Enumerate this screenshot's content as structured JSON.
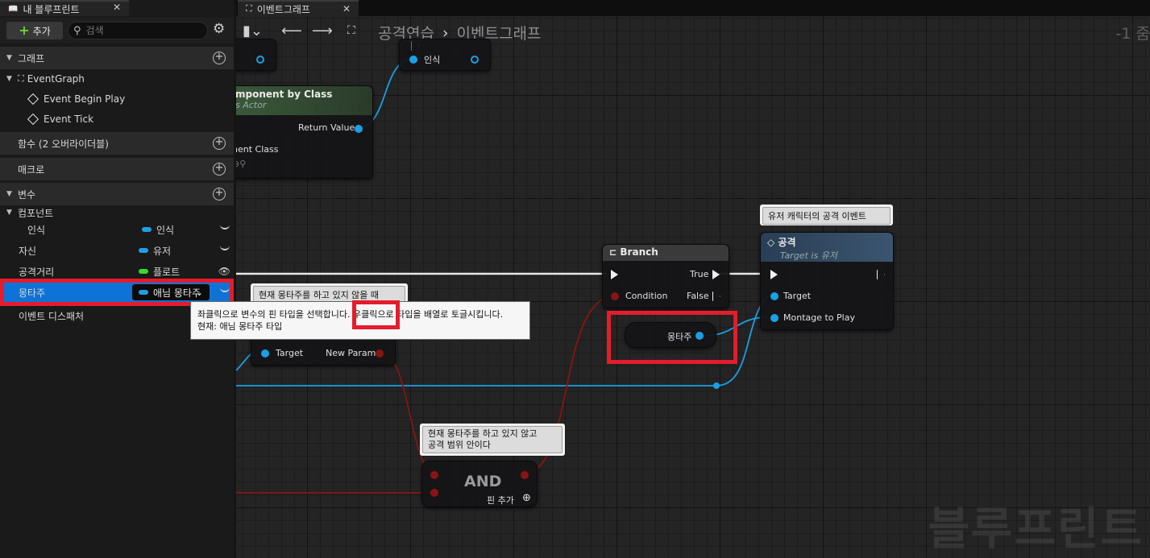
{
  "left_panel": {
    "tab_title": "내 블루프린트",
    "add_label": "추가",
    "search_placeholder": "검색",
    "sections": {
      "graphs": "그래프",
      "functions": "함수 (2 오버라이더블)",
      "macros": "매크로",
      "variables": "변수"
    },
    "event_graph": "EventGraph",
    "events": [
      "Event Begin Play",
      "Event Tick"
    ],
    "components_label": "컴포넌트",
    "variables": [
      {
        "name": "인식",
        "type": "인식",
        "color": "#1e9ee8"
      },
      {
        "name": "자신",
        "type": "유저",
        "color": "#1e9ee8"
      },
      {
        "name": "공격거리",
        "type": "플로트",
        "color": "#38d82a"
      },
      {
        "name": "몽타주",
        "type": "애님 몽타주",
        "color": "#1e9ee8"
      }
    ],
    "event_dispatchers": "이벤트 디스패처"
  },
  "graph": {
    "tab_title": "이벤트그래프",
    "breadcrumb": [
      "공격연습",
      "이벤트그래프"
    ],
    "zoom": "-1 줌",
    "watermark": "블루프린트"
  },
  "nodes": {
    "get_component": {
      "title": "mponent by Class",
      "subtitle": "s Actor",
      "return": "Return Value",
      "class": "nent Class"
    },
    "recognize": {
      "label": "인식"
    },
    "branch": {
      "title": "Branch",
      "true": "True",
      "false": "False",
      "condition": "Condition"
    },
    "attack": {
      "title": "공격",
      "subtitle": "Target is 유저",
      "target": "Target",
      "montage": "Montage to Play"
    },
    "montage_var": {
      "label": "몽타주"
    },
    "setter": {
      "target": "Target",
      "param": "New Param"
    },
    "and": {
      "title": "AND",
      "add_pin": "핀 추가"
    }
  },
  "comments": {
    "attack": "유저 캐릭터의 공격 이벤트",
    "not_montage": "현재 몽타주를 하고 있지 않을 때",
    "and_comment_1": "현재 몽타주를 하고 있지 않고",
    "and_comment_2": "공격 범위 안이다"
  },
  "tooltip": {
    "line1_a": "좌클릭으로 변수의 핀 타입을 선택합니다. ",
    "line1_b": "우클릭으로",
    "line1_c": " 타입을 배열로 토글시킵니다.",
    "line2": "현재: 애님 몽타주 타입"
  }
}
